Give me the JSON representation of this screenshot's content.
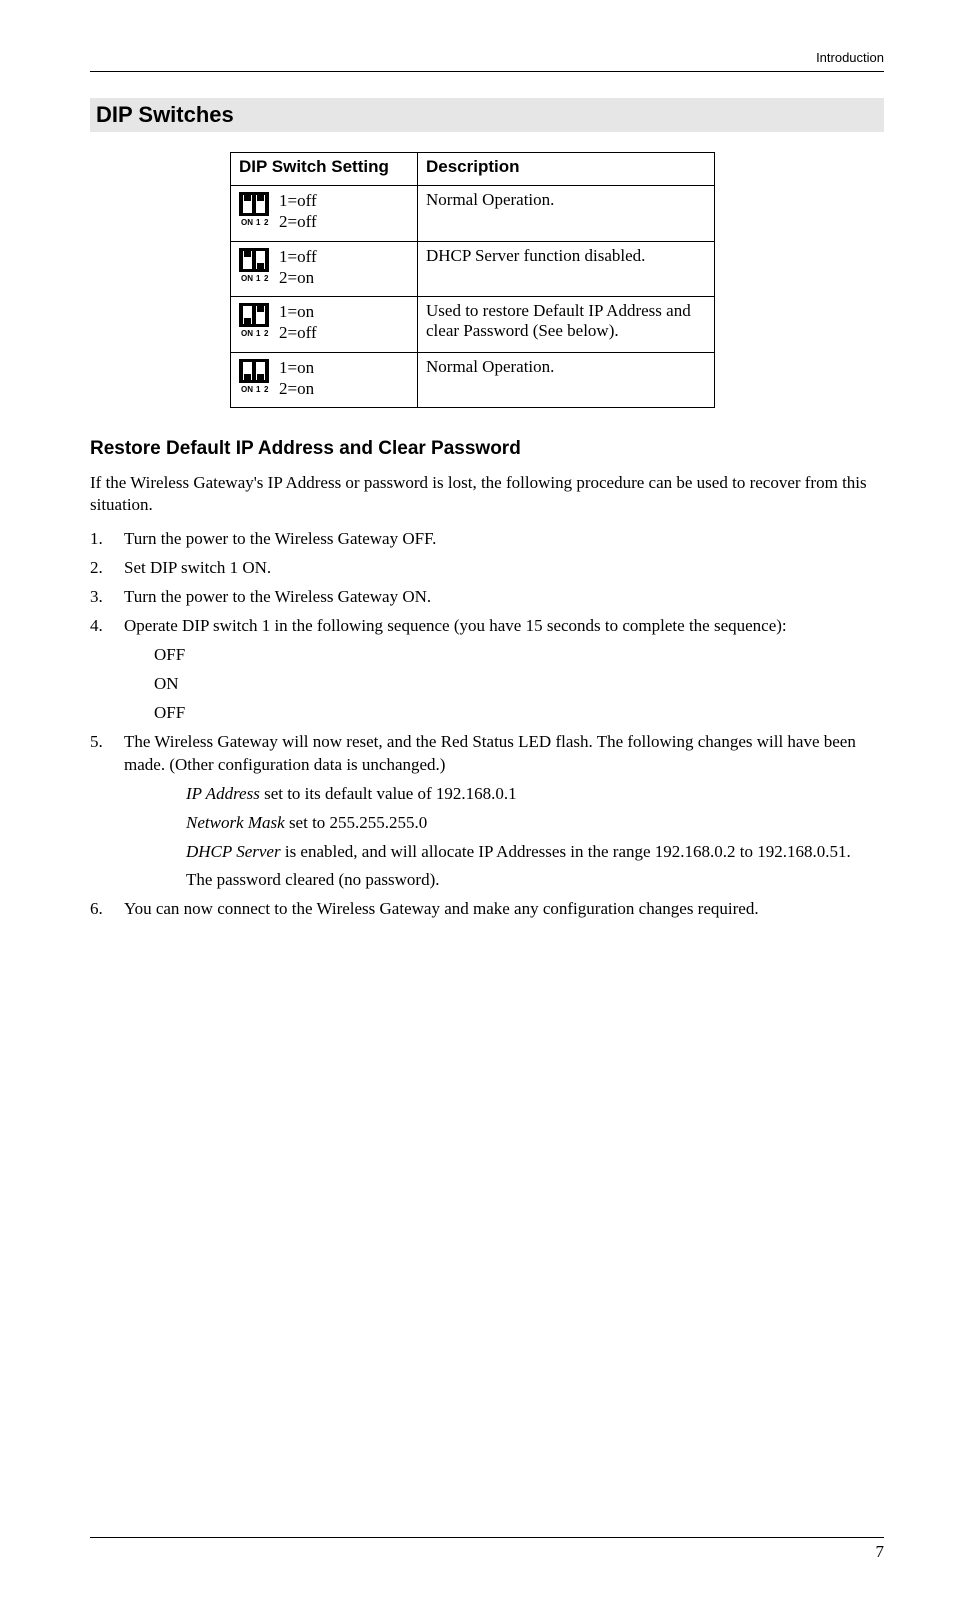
{
  "header": {
    "right": "Introduction"
  },
  "section_heading": "DIP Switches",
  "table": {
    "headers": {
      "setting": "DIP Switch Setting",
      "desc": "Description"
    },
    "rows": [
      {
        "sw1": "1=off",
        "sw2": "2=off",
        "s1": 0,
        "s2": 0,
        "desc": "Normal Operation."
      },
      {
        "sw1": "1=off",
        "sw2": "2=on",
        "s1": 0,
        "s2": 1,
        "desc": "DHCP Server function disabled."
      },
      {
        "sw1": "1=on",
        "sw2": "2=off",
        "s1": 1,
        "s2": 0,
        "desc": "Used to restore Default IP Address and clear Password (See below)."
      },
      {
        "sw1": "1=on",
        "sw2": "2=on",
        "s1": 1,
        "s2": 1,
        "desc": "Normal Operation."
      }
    ]
  },
  "sub_heading": "Restore Default IP Address and Clear Password",
  "intro": "If the Wireless Gateway's IP Address or password is lost, the following procedure can be used to recover from this situation.",
  "steps": {
    "s1": "Turn the power to the Wireless Gateway OFF.",
    "s2": "Set DIP switch 1 ON.",
    "s3": "Turn the power to the Wireless Gateway ON.",
    "s4": "Operate DIP switch 1 in the following sequence (you have 15 seconds to complete the sequence):",
    "s4a": "OFF",
    "s4b": "ON",
    "s4c": "OFF",
    "s5": "The Wireless Gateway will now reset, and the Red Status LED flash. The following changes will have been made. (Other configuration data is unchanged.)",
    "s5a_pre": "IP Address",
    "s5a_post": " set to its default value of 192.168.0.1",
    "s5b_pre": "Network Mask",
    "s5b_post": " set to 255.255.255.0",
    "s5c_pre": "DHCP Server",
    "s5c_post": " is enabled, and will allocate IP Addresses in the range 192.168.0.2 to 192.168.0.51.",
    "s5d": "The password cleared (no password).",
    "s6": "You can now connect to the Wireless Gateway and make any configuration changes required."
  },
  "page_number": "7"
}
